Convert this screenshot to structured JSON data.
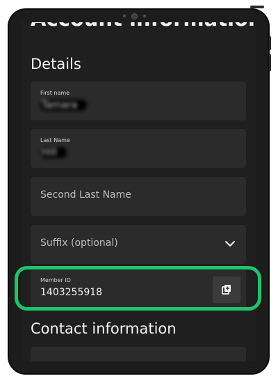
{
  "header": {
    "partial_title": "Account information"
  },
  "details": {
    "title": "Details",
    "first_name": {
      "label": "First name",
      "value": "Tamara"
    },
    "last_name": {
      "label": "Last Name",
      "value": "Hill"
    },
    "second_last_name": {
      "placeholder": "Second Last Name"
    },
    "suffix": {
      "placeholder": "Suffix (optional)"
    },
    "member_id": {
      "label": "Member ID",
      "value": "1403255918"
    }
  },
  "contact": {
    "title": "Contact information"
  },
  "icons": {
    "chevron": "chevron-down-icon",
    "copy": "copy-add-icon"
  },
  "colors": {
    "screen_bg": "#1f1f1f",
    "field_bg": "#2b2b2b",
    "highlight": "#1fc46a",
    "text": "#f2f2f2"
  }
}
